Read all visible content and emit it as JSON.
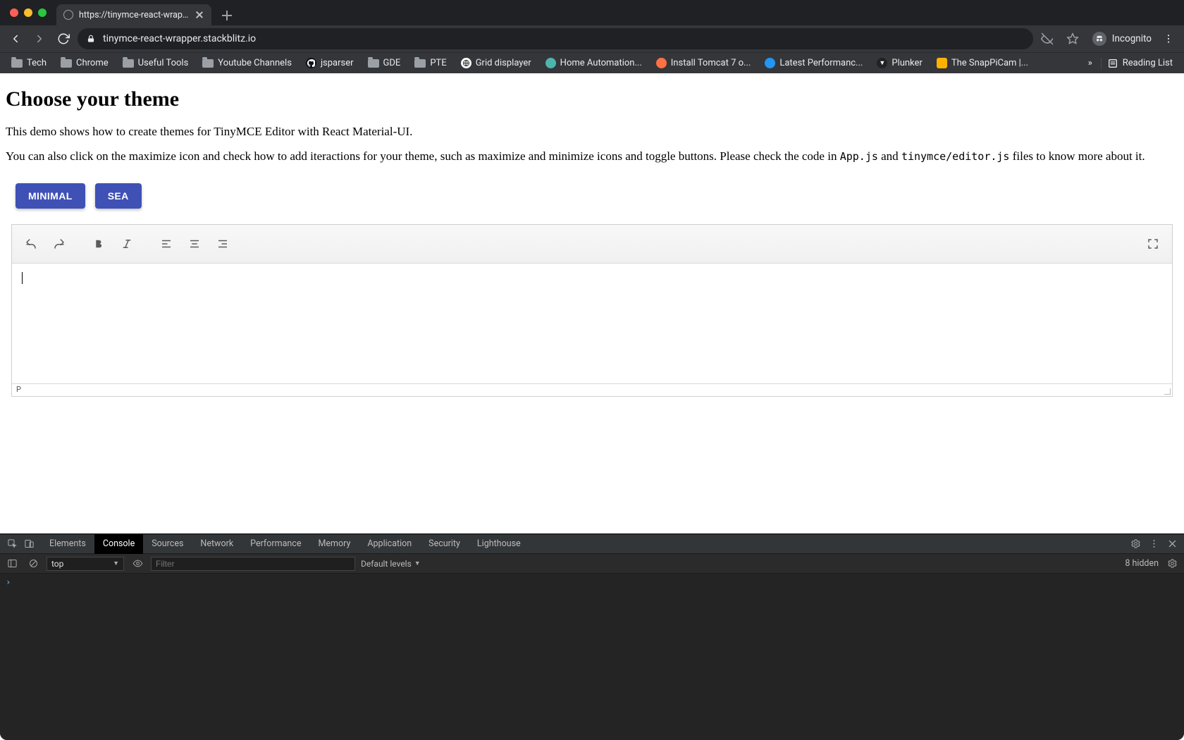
{
  "browser": {
    "tab_title": "https://tinymce-react-wrapper",
    "url_host": "tinymce-react-wrapper.stackblitz.io",
    "incognito_label": "Incognito",
    "bookmarks": [
      {
        "type": "folder",
        "label": "Tech"
      },
      {
        "type": "folder",
        "label": "Chrome"
      },
      {
        "type": "folder",
        "label": "Useful Tools"
      },
      {
        "type": "folder",
        "label": "Youtube Channels"
      },
      {
        "type": "link",
        "label": "jsparser",
        "fav": "gh"
      },
      {
        "type": "folder",
        "label": "GDE"
      },
      {
        "type": "folder",
        "label": "PTE"
      },
      {
        "type": "link",
        "label": "Grid displayer",
        "fav": "globe"
      },
      {
        "type": "link",
        "label": "Home Automation...",
        "fav": "teal"
      },
      {
        "type": "link",
        "label": "Install Tomcat 7 o...",
        "fav": "orange"
      },
      {
        "type": "link",
        "label": "Latest Performanc...",
        "fav": "blue"
      },
      {
        "type": "link",
        "label": "Plunker",
        "fav": "plunker"
      },
      {
        "type": "link",
        "label": "The SnapPiCam |...",
        "fav": "orange-sq"
      }
    ],
    "more_glyph": "»",
    "reading_list": "Reading List"
  },
  "page": {
    "heading": "Choose your theme",
    "para1": "This demo shows how to create themes for TinyMCE Editor with React Material-UI.",
    "para2_a": "You can also click on the maximize icon and check how to add iteractions for your theme, such as maximize and minimize icons and toggle buttons. Please check the code in ",
    "code1": "App.js",
    "para2_b": " and ",
    "code2": "tinymce/editor.js",
    "para2_c": " files to know more about it.",
    "buttons": {
      "minimal": "MINIMAL",
      "sea": "SEA"
    },
    "editor": {
      "status_path": "P"
    }
  },
  "devtools": {
    "tabs": [
      "Elements",
      "Console",
      "Sources",
      "Network",
      "Performance",
      "Memory",
      "Application",
      "Security",
      "Lighthouse"
    ],
    "active_tab": "Console",
    "context": "top",
    "filter_placeholder": "Filter",
    "levels_label": "Default levels",
    "hidden_label": "8 hidden",
    "prompt": "›"
  }
}
